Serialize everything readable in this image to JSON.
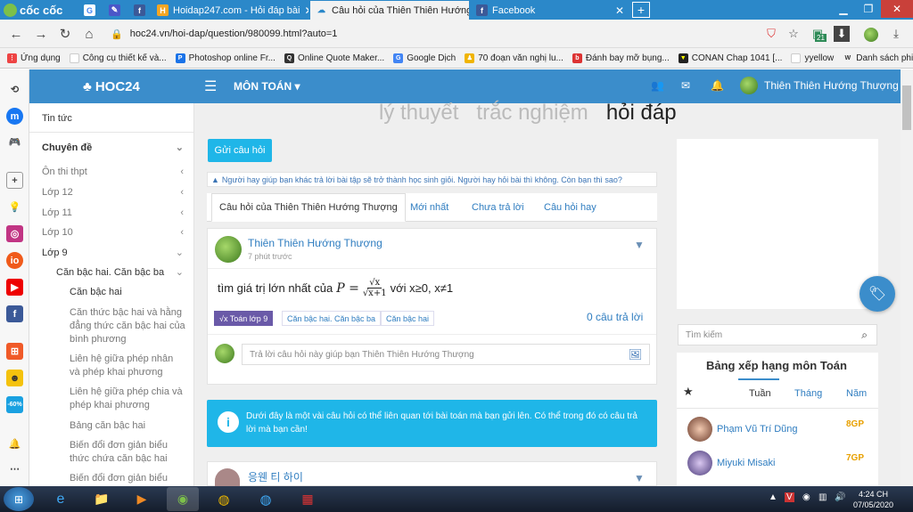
{
  "browser": {
    "brand": "cốc cốc",
    "tabs": [
      {
        "label": "",
        "icon": "google-icon"
      },
      {
        "label": "",
        "icon": "extension-icon"
      },
      {
        "label": "",
        "icon": "facebook-icon"
      },
      {
        "label": "Hoidap247.com - Hỏi đáp bài",
        "icon": "hoidap-icon"
      },
      {
        "label": "Câu hỏi của Thiên Thiên Hướng",
        "icon": "cloud-icon",
        "active": true
      },
      {
        "label": "Facebook",
        "icon": "facebook-icon"
      }
    ],
    "new_tab": "+",
    "url": "hoc24.vn/hoi-dap/question/980099.html?auto=1",
    "bookmarks": [
      "Ứng dụng",
      "Công cụ thiết kế và...",
      "Photoshop online Fr...",
      "Online Quote Maker...",
      "Google Dịch",
      "70 đoạn văn nghị lu...",
      "Đánh bay mỡ bụng...",
      "CONAN Chap 1041 [...",
      "yyellow",
      "Danh sách phim hoạ..."
    ],
    "badge_count": "21"
  },
  "site": {
    "logo": "HOC24",
    "subject_menu": "MÔN TOÁN",
    "user_name": "Thiên Thiên Hướng Thượng"
  },
  "sidebar": {
    "items": [
      {
        "label": "Tin tức"
      },
      {
        "label": "Chuyên đề"
      },
      {
        "label": "Ôn thi thpt"
      },
      {
        "label": "Lớp 12"
      },
      {
        "label": "Lớp 11"
      },
      {
        "label": "Lớp 10"
      },
      {
        "label": "Lớp 9"
      },
      {
        "label": "Căn bậc hai. Căn bậc ba"
      },
      {
        "label": "Căn bậc hai"
      },
      {
        "label": "Căn thức bậc hai và hằng đẳng thức căn bậc hai của bình phương"
      },
      {
        "label": "Liên hệ giữa phép nhân và phép khai phương"
      },
      {
        "label": "Liên hệ giữa phép chia và phép khai phương"
      },
      {
        "label": "Bảng căn bậc hai"
      },
      {
        "label": "Biến đổi đơn giản biểu thức chứa căn bậc hai"
      },
      {
        "label": "Biến đổi đơn giản biểu thức"
      }
    ]
  },
  "main": {
    "ghost_tabs": [
      "lý thuyết",
      "trắc nghiệm",
      "hỏi đáp"
    ],
    "ask_button": "Gửi câu hỏi",
    "notice": "Người hay giúp bạn khác trả lời bài tập sẽ trở thành học sinh giỏi. Người hay hỏi bài thì không. Còn bạn thì sao?",
    "tabs": [
      "Câu hỏi của Thiên Thiên Hướng Thượng",
      "Mới nhất",
      "Chưa trả lời",
      "Câu hỏi hay"
    ],
    "question": {
      "author": "Thiên Thiên Hướng Thượng",
      "time": "7 phút trước",
      "text_before": "tìm giá trị lớn nhất của",
      "formula_var": "P =",
      "formula_num": "√x",
      "formula_den": "√x+1",
      "text_after": "với x≥0, x≠1",
      "tags": [
        "√x Toán lớp 9",
        "Căn bậc hai. Căn bậc ba",
        "Căn bậc hai"
      ],
      "answers": "0 câu trả lời",
      "reply_placeholder": "Trả lời câu hỏi này giúp bạn Thiên Thiên Hướng Thượng"
    },
    "info": "Dưới đây là một vài câu hỏi có thể liên quan tới bài toán mà bạn gửi lên. Có thể trong đó có câu trả lời mà bạn cần!",
    "next_author": "응웬 티 하이"
  },
  "right": {
    "search_placeholder": "Tìm kiếm",
    "rank_title": "Bảng xếp hạng môn Toán",
    "rank_tabs": [
      "Tuần",
      "Tháng",
      "Năm"
    ],
    "rows": [
      {
        "name": "Phạm Vũ Trí Dũng",
        "gp": "8GP"
      },
      {
        "name": "Miyuki Misaki",
        "gp": "7GP"
      }
    ]
  },
  "taskbar": {
    "time": "4:24 CH",
    "date": "07/05/2020"
  },
  "colors": {
    "site_blue": "#3b8dcb",
    "cyan": "#1fb6e8",
    "tab_strip": "#2b88c9"
  }
}
